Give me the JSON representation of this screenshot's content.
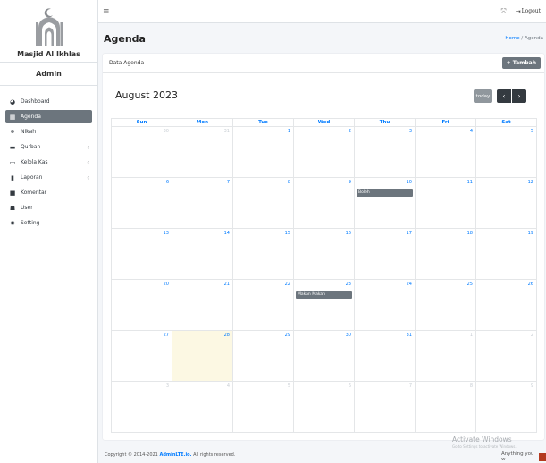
{
  "sidebar": {
    "brand_name": "Masjid Al Ikhlas",
    "user_name": "Admin",
    "items": [
      {
        "label": "Dashboard",
        "icon": "dashboard-icon",
        "active": false,
        "caret": false
      },
      {
        "label": "Agenda",
        "icon": "calendar-icon",
        "active": true,
        "caret": false
      },
      {
        "label": "Nikah",
        "icon": "rings-icon",
        "active": false,
        "caret": false
      },
      {
        "label": "Qurban",
        "icon": "cow-icon",
        "active": false,
        "caret": true
      },
      {
        "label": "Kelola Kas",
        "icon": "money-icon",
        "active": false,
        "caret": true
      },
      {
        "label": "Laporan",
        "icon": "file-icon",
        "active": false,
        "caret": true
      },
      {
        "label": "Komentar",
        "icon": "comment-icon",
        "active": false,
        "caret": false
      },
      {
        "label": "User",
        "icon": "users-icon",
        "active": false,
        "caret": false
      },
      {
        "label": "Setting",
        "icon": "gear-icon",
        "active": false,
        "caret": false
      }
    ]
  },
  "topbar": {
    "logout_label": "Logout"
  },
  "header": {
    "title": "Agenda",
    "breadcrumb_home": "Home",
    "breadcrumb_sep": " / ",
    "breadcrumb_current": "Agenda"
  },
  "card": {
    "title": "Data Agenda",
    "add_button": "+ Tambah"
  },
  "calendar": {
    "month_title": "August 2023",
    "today_label": "today",
    "prev_glyph": "‹",
    "next_glyph": "›",
    "weekdays": [
      "Sun",
      "Mon",
      "Tue",
      "Wed",
      "Thu",
      "Fri",
      "Sat"
    ],
    "weeks": [
      [
        {
          "n": "30",
          "other": true
        },
        {
          "n": "31",
          "other": true
        },
        {
          "n": "1"
        },
        {
          "n": "2"
        },
        {
          "n": "3"
        },
        {
          "n": "4"
        },
        {
          "n": "5"
        }
      ],
      [
        {
          "n": "6"
        },
        {
          "n": "7"
        },
        {
          "n": "8"
        },
        {
          "n": "9"
        },
        {
          "n": "10",
          "event": "Boleh"
        },
        {
          "n": "11"
        },
        {
          "n": "12"
        }
      ],
      [
        {
          "n": "13"
        },
        {
          "n": "14"
        },
        {
          "n": "15"
        },
        {
          "n": "16"
        },
        {
          "n": "17"
        },
        {
          "n": "18"
        },
        {
          "n": "19"
        }
      ],
      [
        {
          "n": "20"
        },
        {
          "n": "21"
        },
        {
          "n": "22"
        },
        {
          "n": "23",
          "event": "Makan Makan"
        },
        {
          "n": "24"
        },
        {
          "n": "25"
        },
        {
          "n": "26"
        }
      ],
      [
        {
          "n": "27"
        },
        {
          "n": "28",
          "today": true
        },
        {
          "n": "29"
        },
        {
          "n": "30"
        },
        {
          "n": "31"
        },
        {
          "n": "1",
          "other": true
        },
        {
          "n": "2",
          "other": true
        }
      ],
      [
        {
          "n": "3",
          "other": true
        },
        {
          "n": "4",
          "other": true
        },
        {
          "n": "5",
          "other": true
        },
        {
          "n": "6",
          "other": true
        },
        {
          "n": "7",
          "other": true
        },
        {
          "n": "8",
          "other": true
        },
        {
          "n": "9",
          "other": true
        }
      ]
    ]
  },
  "footer": {
    "prefix": "Copyright © 2014-2021 ",
    "brand": "AdminLTE.io.",
    "suffix": " All rights reserved."
  },
  "watermark": {
    "title": "Activate Windows",
    "subtitle": "Go to Settings to activate Windows.",
    "overlay_text": "Anything you w"
  },
  "colors": {
    "accent": "#007bff",
    "active_nav": "#6c757d",
    "today_bg": "#fcf8e3"
  }
}
